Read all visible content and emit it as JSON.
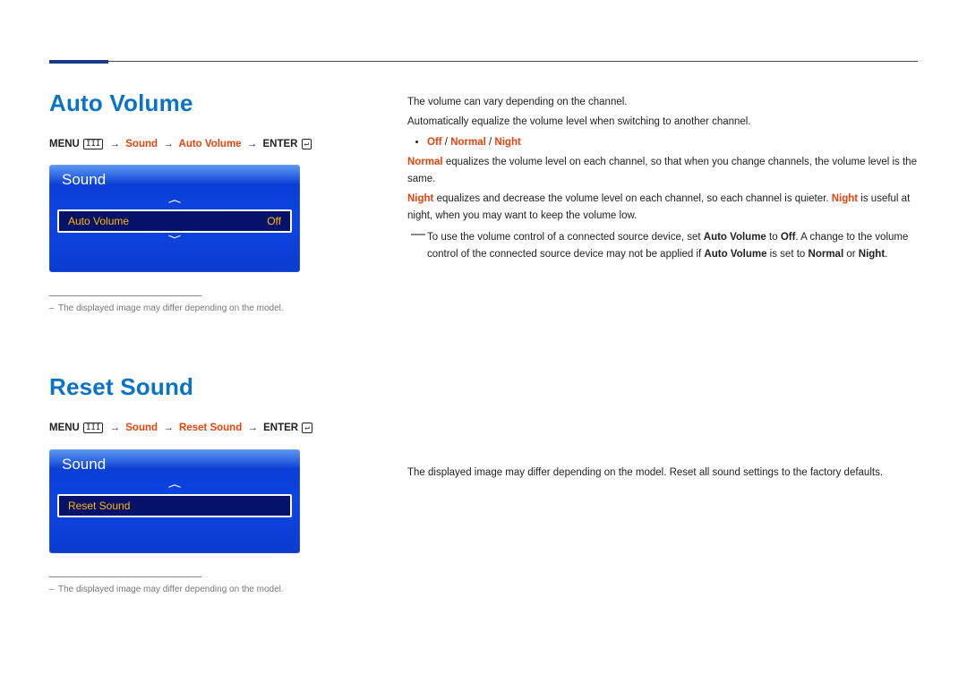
{
  "section1": {
    "title": "Auto Volume",
    "crumb": {
      "menu": "MENU",
      "menu_icon": "III",
      "p1": "Sound",
      "p2": "Auto Volume",
      "enter": "ENTER",
      "enter_icon": "↵"
    },
    "osd": {
      "header": "Sound",
      "item_label": "Auto Volume",
      "item_value": "Off"
    },
    "footnote": "The displayed image may differ depending on the model."
  },
  "section2": {
    "title": "Reset Sound",
    "crumb": {
      "menu": "MENU",
      "menu_icon": "III",
      "p1": "Sound",
      "p2": "Reset Sound",
      "enter": "ENTER",
      "enter_icon": "↵"
    },
    "osd": {
      "header": "Sound",
      "item_label": "Reset Sound"
    },
    "footnote": "The displayed image may differ depending on the model."
  },
  "right1": {
    "l1": "The volume can vary depending on the channel.",
    "l2": "Automatically equalize the volume level when switching to another channel.",
    "bullet_off": "Off",
    "bullet_sep": " / ",
    "bullet_normal": "Normal",
    "bullet_night": "Night",
    "l3a": "Normal",
    "l3b": " equalizes the volume level on each channel, so that when you change channels, the volume level is the same.",
    "l4a": "Night",
    "l4b": " equalizes and decrease the volume level on each channel, so each channel is quieter. ",
    "l4c": "Night",
    "l4d": " is useful at night, when you may want to keep the volume low.",
    "tip1a": "To use the volume control of a connected source device, set ",
    "tip1b": "Auto Volume",
    "tip1c": " to ",
    "tip1d": "Off",
    "tip1e": ". A change to the volume control of the connected source device may not be applied if ",
    "tip1f": "Auto Volume",
    "tip1g": " is set to ",
    "tip1h": "Normal",
    "tip1i": " or ",
    "tip1j": "Night",
    "tip1k": "."
  },
  "right2": {
    "l1": "The displayed image may differ depending on the model. Reset all sound settings to the factory defaults."
  }
}
